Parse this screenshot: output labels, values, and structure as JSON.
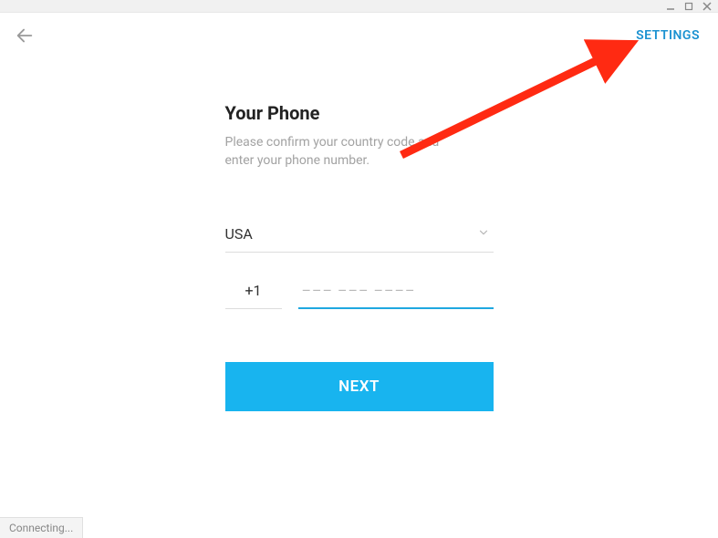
{
  "header": {
    "settings_label": "SETTINGS"
  },
  "content": {
    "title": "Your Phone",
    "subtitle_line1": "Please confirm your country code and",
    "subtitle_line2": "enter your phone number."
  },
  "form": {
    "country": "USA",
    "code_value": "+1",
    "phone_placeholder": "––– ––– ––––",
    "next_label": "NEXT"
  },
  "status": {
    "connecting": "Connecting..."
  }
}
